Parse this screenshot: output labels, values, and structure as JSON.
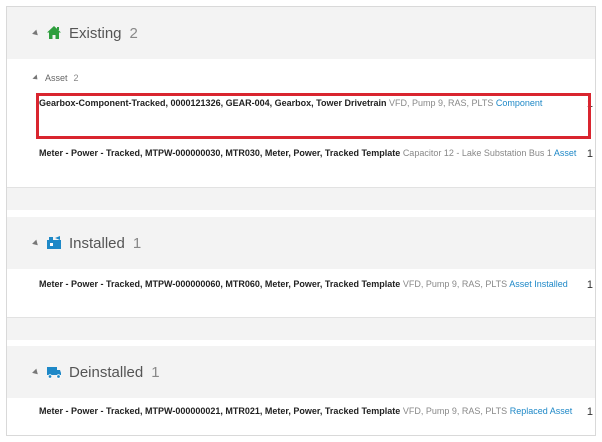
{
  "groups": {
    "existing": {
      "title": "Existing",
      "count": "2",
      "sub": {
        "title": "Asset",
        "count": "2"
      },
      "rows": [
        {
          "name": "Gearbox-Component-Tracked, 0000121326, GEAR-004, Gearbox, Tower Drivetrain",
          "desc": "VFD, Pump 9, RAS, PLTS",
          "link": "Component",
          "qty": "1"
        },
        {
          "name": "Meter - Power - Tracked, MTPW-000000030, MTR030, Meter, Power, Tracked Template",
          "desc": "Capacitor 12 - Lake Substation Bus 1",
          "link": "Asset",
          "qty": "1"
        }
      ]
    },
    "installed": {
      "title": "Installed",
      "count": "1",
      "rows": [
        {
          "name": "Meter - Power - Tracked, MTPW-000000060, MTR060, Meter, Power, Tracked Template",
          "desc": "VFD, Pump 9, RAS, PLTS",
          "link": "Asset Installed",
          "qty": "1"
        }
      ]
    },
    "deinstalled": {
      "title": "Deinstalled",
      "count": "1",
      "rows": [
        {
          "name": "Meter - Power - Tracked, MTPW-000000021, MTR021, Meter, Power, Tracked Template",
          "desc": "VFD, Pump 9, RAS, PLTS",
          "link": "Replaced Asset",
          "qty": "1"
        }
      ]
    }
  },
  "colors": {
    "link": "#1e88c7",
    "icon_green": "#2e9e3e",
    "icon_blue": "#1e88c7",
    "highlight": "#d9252f"
  },
  "icons": {
    "existing": "house-icon",
    "installed": "installed-icon",
    "deinstalled": "truck-icon"
  }
}
